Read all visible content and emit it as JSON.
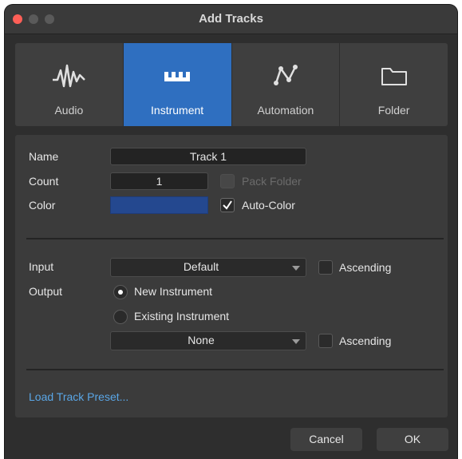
{
  "window": {
    "title": "Add Tracks"
  },
  "tabs": [
    {
      "label": "Audio",
      "icon": "waveform-icon"
    },
    {
      "label": "Instrument",
      "icon": "piano-keys-icon",
      "active": true
    },
    {
      "label": "Automation",
      "icon": "automation-curve-icon"
    },
    {
      "label": "Folder",
      "icon": "folder-icon"
    }
  ],
  "form": {
    "name_label": "Name",
    "name_value": "Track 1",
    "count_label": "Count",
    "count_value": "1",
    "pack_folder_label": "Pack Folder",
    "color_label": "Color",
    "color_value": "#24488f",
    "auto_color_label": "Auto-Color",
    "auto_color_checked": true,
    "input_label": "Input",
    "input_value": "Default",
    "input_ascending_label": "Ascending",
    "output_label": "Output",
    "new_instrument_label": "New Instrument",
    "existing_instrument_label": "Existing Instrument",
    "existing_value": "None",
    "existing_ascending_label": "Ascending"
  },
  "footer": {
    "load_preset_label": "Load Track Preset...",
    "cancel_label": "Cancel",
    "ok_label": "OK"
  },
  "colors": {
    "accent": "#2f6fc0",
    "link": "#5aa6e6",
    "close": "#fe5f57"
  }
}
